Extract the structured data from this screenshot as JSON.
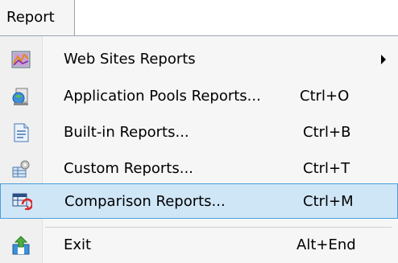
{
  "menubar": {
    "title": "Report"
  },
  "menu": {
    "items": [
      {
        "label": "Web Sites Reports",
        "shortcut": "",
        "submenu": true,
        "icon": "web-sites-reports-icon"
      },
      {
        "label": "Application Pools Reports...",
        "shortcut": "Ctrl+O",
        "icon": "application-pools-icon"
      },
      {
        "label": "Built-in Reports...",
        "shortcut": "Ctrl+B",
        "icon": "built-in-reports-icon"
      },
      {
        "label": "Custom Reports...",
        "shortcut": "Ctrl+T",
        "icon": "custom-reports-icon"
      },
      {
        "label": "Comparison Reports...",
        "shortcut": "Ctrl+M",
        "icon": "comparison-reports-icon",
        "highlighted": true
      },
      {
        "label": "Exit",
        "shortcut": "Alt+End",
        "icon": "exit-icon"
      }
    ]
  },
  "colors": {
    "highlight_bg": "#cfe6f7",
    "highlight_border": "#4c9ed9"
  }
}
